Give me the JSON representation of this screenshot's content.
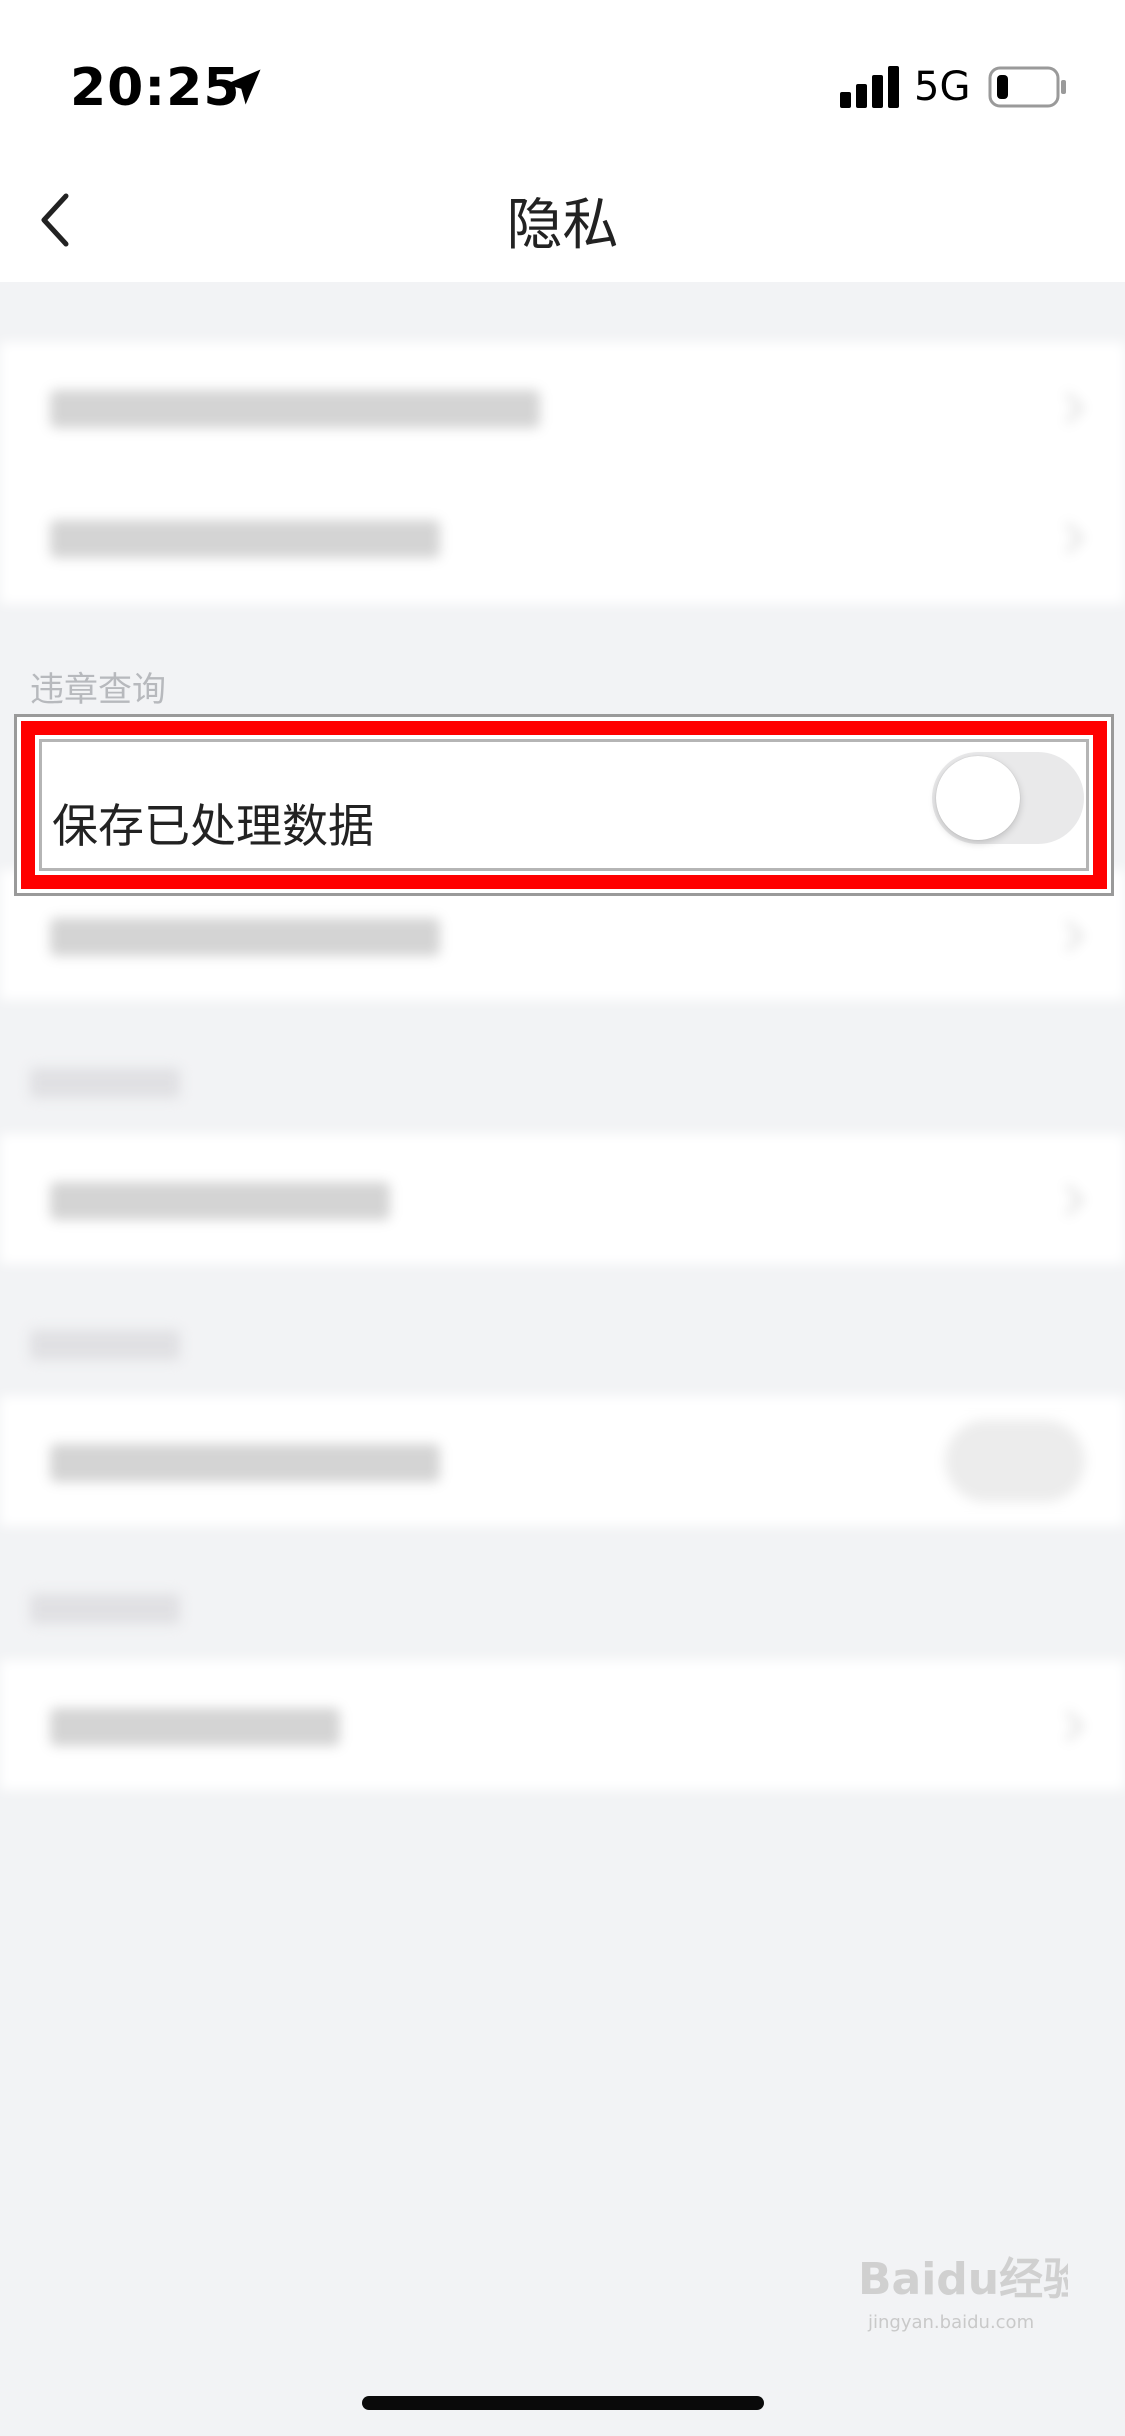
{
  "status_bar": {
    "time": "20:25",
    "network": "5G",
    "icons": [
      "location-arrow-icon",
      "signal-bars-icon",
      "battery-low-icon"
    ]
  },
  "nav": {
    "title": "隐私",
    "back_icon": "chevron-left-icon"
  },
  "sections": {
    "violation_query": {
      "label": "违章查询",
      "toggle_row": {
        "label": "保存已处理数据",
        "toggle_on": false
      }
    }
  },
  "colors": {
    "highlight": "#ff0000",
    "background": "#f2f3f5",
    "toggle_off": "#e9e9ea"
  },
  "watermark": {
    "logo": "Baidu经验",
    "sub": "jingyan.baidu.com"
  }
}
